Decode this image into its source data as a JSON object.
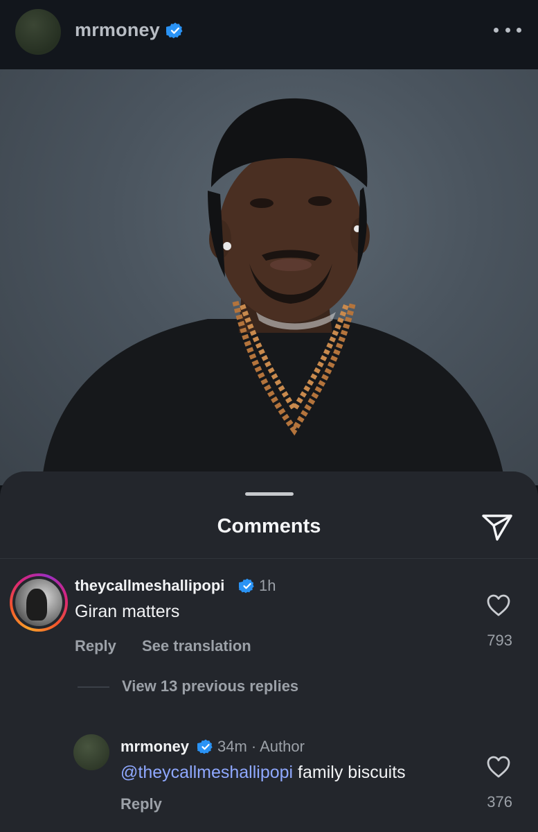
{
  "header": {
    "username": "mrmoney",
    "verified_icon": "verified-badge-icon",
    "more_icon": "more-horizontal-icon"
  },
  "post": {
    "image_icon": "post-photo"
  },
  "comments": {
    "title": "Comments",
    "share_icon": "send-icon",
    "top_comment": {
      "username": "theycallmeshallipopi",
      "time": "1h",
      "text": "Giran matters",
      "reply_label": "Reply",
      "translate_label": "See translation",
      "likes": "793"
    },
    "view_replies_label": "View 13 previous replies",
    "reply": {
      "username": "mrmoney",
      "meta": "34m · Author",
      "mention": "@theycallmeshallipopi",
      "text": " family biscuits",
      "reply_label": "Reply",
      "likes": "376"
    }
  },
  "colors": {
    "sheet_bg": "#23262c",
    "header_bg": "#12161c",
    "verified_blue": "#2a93f5",
    "mention_blue": "#8fa8ff",
    "muted_text": "#9ca1a8"
  }
}
